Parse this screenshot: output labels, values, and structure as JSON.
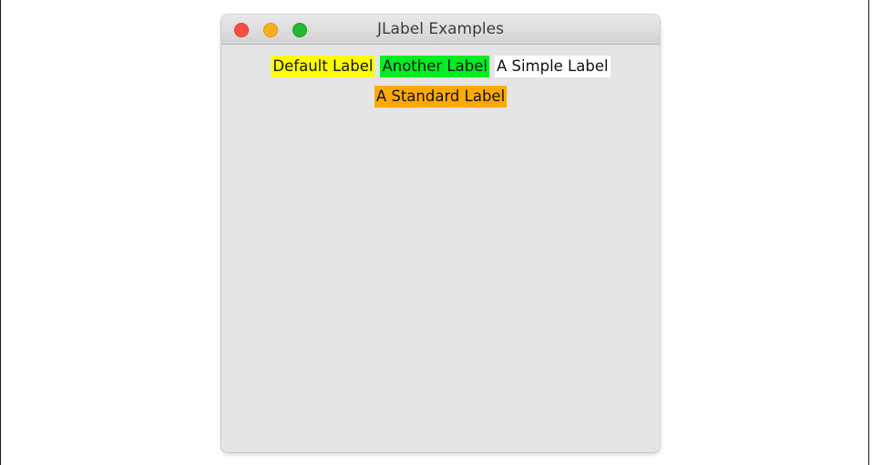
{
  "window": {
    "title": "JLabel Examples",
    "controls": {
      "close_color": "#fd4e45",
      "minimize_color": "#feae18",
      "zoom_color": "#25b833"
    },
    "background": "#e5e5e5"
  },
  "labels": [
    {
      "text": "Default Label",
      "background": "#ffff00"
    },
    {
      "text": "Another Label",
      "background": "#00ee22"
    },
    {
      "text": "A Simple Label",
      "background": "#ffffff"
    },
    {
      "text": "A Standard Label",
      "background": "#ffaa00"
    }
  ]
}
